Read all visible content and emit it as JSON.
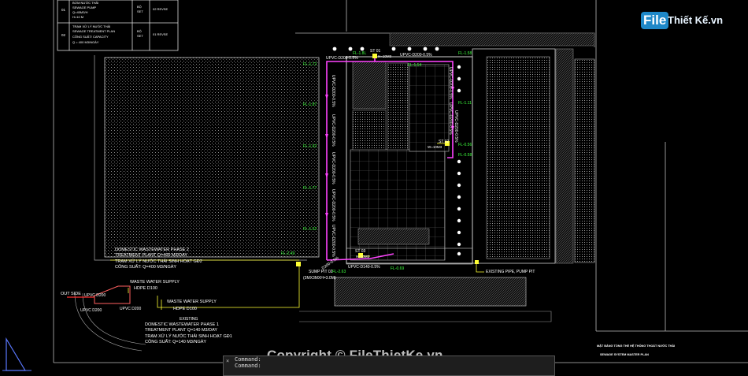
{
  "legend_table": {
    "rows": [
      {
        "no": "01",
        "desc": [
          "BƠM NƯỚC THẢI",
          "SEWAGE PUMP",
          "Q=45M3/H",
          "H=10 M"
        ],
        "unit": [
          "BỘ",
          "SET"
        ],
        "qty": "02 REVSE"
      },
      {
        "no": "02",
        "desc": [
          "TRẠM XỬ LÝ NƯỚC THẢI",
          "SEWAGE TREATMENT PLAN",
          "CÔNG SUẤT/ CAPACITY",
          "Q = 400 M3/NGÀY"
        ],
        "unit": [
          "BỘ",
          "SET"
        ],
        "qty": "01 REVSE"
      }
    ]
  },
  "pipe_labels": {
    "top_left": "UPVC-D200-0.5%",
    "top_right": "UPVC-D200-0.5%",
    "vertical_left": [
      "UPVC-D200-0.5%",
      "UPVC-D200-0.5%",
      "UPVC-D200-0.5%",
      "UPVC-D200-0.5%",
      "UPVC-D200-0.5%"
    ],
    "vertical_right": [
      "UPVC-D200-0.5%",
      "UPVC-D200-0.5%",
      "UPVC-D200-0.5%"
    ],
    "bottom": "UPVC-D140-0.5%",
    "bottom2": "D200-0.5%"
  },
  "levels": {
    "left": [
      "FL-1.72",
      "FL-1.87",
      "FL-1.92",
      "FL-1.77",
      "FL-1.52"
    ],
    "top": [
      "FL-1.8L",
      "FL-1.54"
    ],
    "right_top": "FL-1.58",
    "right": [
      "FL-1.11",
      "FL-0.56",
      "FL-0.58"
    ],
    "bottom_left": "FL-2.49",
    "bottom_mid": "FL-2.63",
    "bottom_right": "FL-0.69"
  },
  "stations": {
    "st01": [
      "ST 01",
      "H=10M3"
    ],
    "st02": [
      "ST 02",
      "W=10M3"
    ],
    "st03": [
      "ST 03",
      "H=10M3"
    ],
    "sump": [
      "SUMP PIT 02",
      "(3MX3MXH=3.0M)"
    ]
  },
  "annotations": {
    "phase2": [
      "DOMESTIC WASTEWATER PHASE 2",
      "TREATMENT PLANT Q=400 M3/DAY",
      "TRẠM XỬ LÝ NƯỚC THẢI SINH HOẠT GĐ2",
      "CÔNG SUẤT: Q=400 M3/NGÀY"
    ],
    "waste_supply_1": [
      "WASTE WATER SUPPLY",
      "HDPE D100"
    ],
    "waste_supply_2": [
      "WASTE WATER SUPPLY",
      "HDPE D100"
    ],
    "out_side": "OUT SIDE",
    "upvc_d200_1": "UPVC D200",
    "upvc_d200_2": "UPVC D200",
    "upvc_d200_3": "UPVC D200",
    "existing": [
      "EXISTING",
      "DOMESTIC WASTEWATER PHASE 1",
      "TREATMENT PLANT Q=140 M3/DAY",
      "TRẠM XỬ LÝ NƯỚC THẢI SINH HOẠT GĐ1",
      "CÔNG SUẤT: Q=140 M3/NGÀY"
    ],
    "existing_pipe": "EXISTING PIPE, PUMP PIT",
    "title_block": [
      "MẶT BẰNG TỔNG THỂ HỆ THỐNG THOÁT NƯỚC THẢI",
      "SEWAGE SYSTEM MASTER PLAN"
    ]
  },
  "command_line": {
    "close": "×",
    "lines": [
      "Command:",
      "Command:"
    ]
  },
  "watermark": {
    "logo_file": "File",
    "logo_rest": "Thiết Kế.vn",
    "copyright": "Copyright © FileThietKe.vn"
  },
  "colors": {
    "pipe": "#ff44ff",
    "level": "#3dff3d",
    "leader": "#ffff33",
    "drawing": "#c8c8c8",
    "background": "#000000"
  }
}
